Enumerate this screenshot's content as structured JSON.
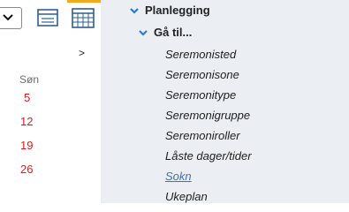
{
  "calendar": {
    "view_select_value": "",
    "next_label": ">",
    "day_header": "Søn",
    "sunday_dates": [
      "5",
      "12",
      "19",
      "26"
    ],
    "accent_color": "#f2a91e",
    "weekend_color": "#e01b1b"
  },
  "nav": {
    "section_label": "Planlegging",
    "subsection_label": "Gå til...",
    "items": [
      {
        "label": "Seremonisted"
      },
      {
        "label": "Seremonisone"
      },
      {
        "label": "Seremonitype"
      },
      {
        "label": "Seremonigruppe"
      },
      {
        "label": "Seremoniroller"
      },
      {
        "label": "Låste dager/tider"
      },
      {
        "label": "Sokn"
      },
      {
        "label": "Ukeplan"
      }
    ],
    "link_color": "#3d71b6",
    "chevron_color": "#2a7bd4"
  }
}
